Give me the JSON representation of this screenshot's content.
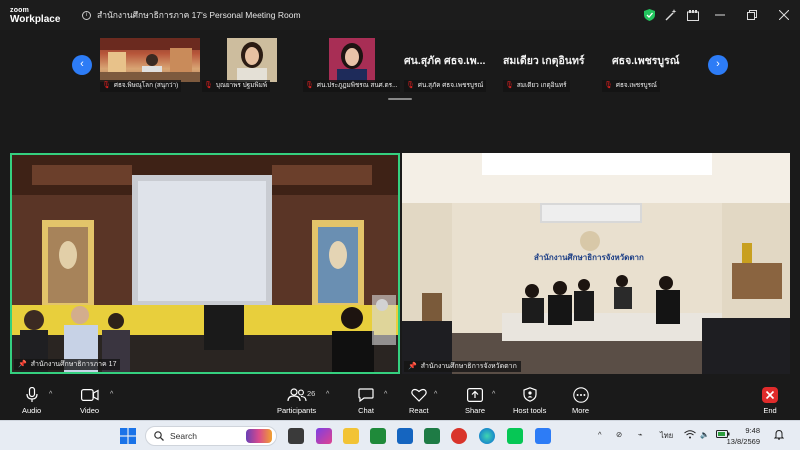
{
  "app": {
    "logo_line1": "zoom",
    "logo_line2": "Workplace",
    "window_title": "สำนักงานศึกษาธิการภาค 17's Personal Meeting Room"
  },
  "strip": {
    "prev_label": "‹",
    "next_label": "›",
    "thumbnails": [
      {
        "name": "ศธจ.พิษณุโลก (สนุกว่า)"
      },
      {
        "name": "บุณยาพร ปฐมพิมพ์"
      },
      {
        "name": "ศน.ประภูฏมพิชรณ สนศ.ตร..."
      },
      {
        "name": "ศน.สุภัค ศธจ.เพชรบูรณ์",
        "big_label": "ศน.สุภัค ศธจ.เพ..."
      },
      {
        "name": "สมเดียว เกตุอินทร์",
        "big_label": "สมเดียว เกตุอินทร์"
      },
      {
        "name": "ศธจ.เพชรบูรณ์",
        "big_label": "ศธจ.เพชรบูรณ์"
      }
    ]
  },
  "tiles": {
    "left_label": "สำนักงานศึกษาธิการภาค 17",
    "right_label": "สำนักงานศึกษาธิการจังหวัดตาก",
    "right_banner": "สำนักงานศึกษาธิการจังหวัดตาก"
  },
  "toolbar": {
    "audio": "Audio",
    "video": "Video",
    "participants": "Participants",
    "participants_count": "26",
    "chat": "Chat",
    "react": "React",
    "share": "Share",
    "host_tools": "Host tools",
    "more": "More",
    "end": "End"
  },
  "taskbar": {
    "search_placeholder": "Search",
    "language": "ไทย",
    "time": "9:48",
    "date": "13/8/2569"
  },
  "colors": {
    "accent_blue": "#2d7cf6",
    "active_speaker": "#35d07f",
    "end_red": "#e02b2b",
    "mic_off_red": "#e02020"
  }
}
